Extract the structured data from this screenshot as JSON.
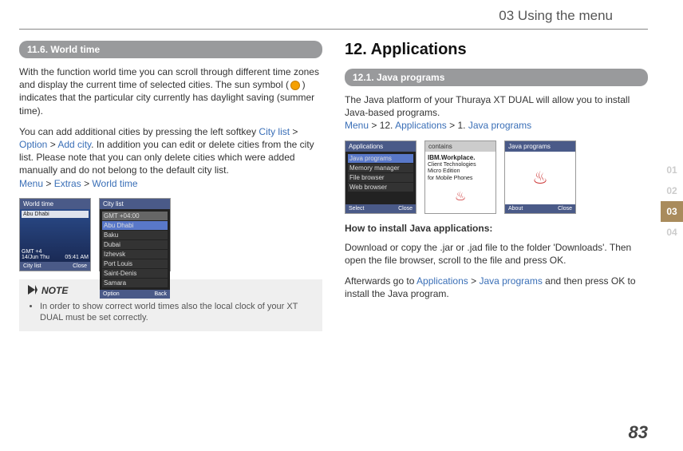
{
  "header": {
    "chapter_title": "03 Using the menu"
  },
  "chapter_tabs": {
    "t1": "01",
    "t2": "02",
    "t3": "03",
    "t4": "04"
  },
  "page_number": "83",
  "left": {
    "heading_11_6": "11.6. World time",
    "para1a": "With the function world time you can scroll through different time zones and display the current time of selected cities. The sun symbol ( ",
    "para1b": " ) indicates that the particular city currently has daylight saving (summer time).",
    "para2a": "You can add additional cities by pressing the left softkey ",
    "city_list": "City list",
    "gt1": " > ",
    "option": "Option",
    "gt2": " > ",
    "add_city": "Add city",
    "para2b": ". In addition you can edit or delete cities from the city list. Please note that you can only delete cities which were added manually and do not belong to the default city list.",
    "menu": "Menu",
    "gt3": " > ",
    "extras": "Extras",
    "gt4": " > ",
    "world_time": "World time",
    "thumb1": {
      "header": "World time",
      "city": "Abu Dhabi",
      "gmt": "GMT +4",
      "date": "14/Jun Thu",
      "time": "05:41 AM",
      "foot_left": "City list",
      "foot_right": "Close"
    },
    "thumb2": {
      "header": "City list",
      "gmt": "GMT +04:00",
      "r1": "Abu Dhabi",
      "r2": "Baku",
      "r3": "Dubai",
      "r4": "Izhevsk",
      "r5": "Port Louis",
      "r6": "Saint-Denis",
      "r7": "Samara",
      "foot_left": "Option",
      "foot_right": "Back"
    },
    "note_label": "NOTE",
    "note_bullet": "In order to show correct world times also the local clock of your XT DUAL must be set correctly."
  },
  "right": {
    "h2": "12. Applications",
    "heading_12_1": "12.1. Java programs",
    "para1": "The Java platform of your Thuraya XT DUAL will allow you to install Java-based programs.",
    "menu": "Menu",
    "gt1": " > 12. ",
    "applications": "Applications",
    "gt2": " > 1. ",
    "java_programs": "Java programs",
    "thumb1": {
      "header": "Applications",
      "r1": "Java programs",
      "r2": "Memory manager",
      "r3": "File browser",
      "r4": "Web browser",
      "foot_left": "Select",
      "foot_right": "Close"
    },
    "thumb2": {
      "header": "contains",
      "ibm": "IBM.Workplace.",
      "line2": "Client Technologies",
      "line3": "Micro Edition",
      "line4": "for Mobile Phones"
    },
    "thumb3": {
      "header": "Java programs",
      "foot_left": "About",
      "foot_right": "Close"
    },
    "howto_heading": "How to install Java applications:",
    "howto_p1": "Download or copy the .jar or .jad file to the folder 'Downloads'. Then open the file browser, scroll to the file and press OK.",
    "howto_p2a": "Afterwards go to ",
    "howto_applications": "Applications",
    "howto_gt": " > ",
    "howto_java": "Java programs",
    "howto_p2b": " and then press OK to install the Java program."
  }
}
